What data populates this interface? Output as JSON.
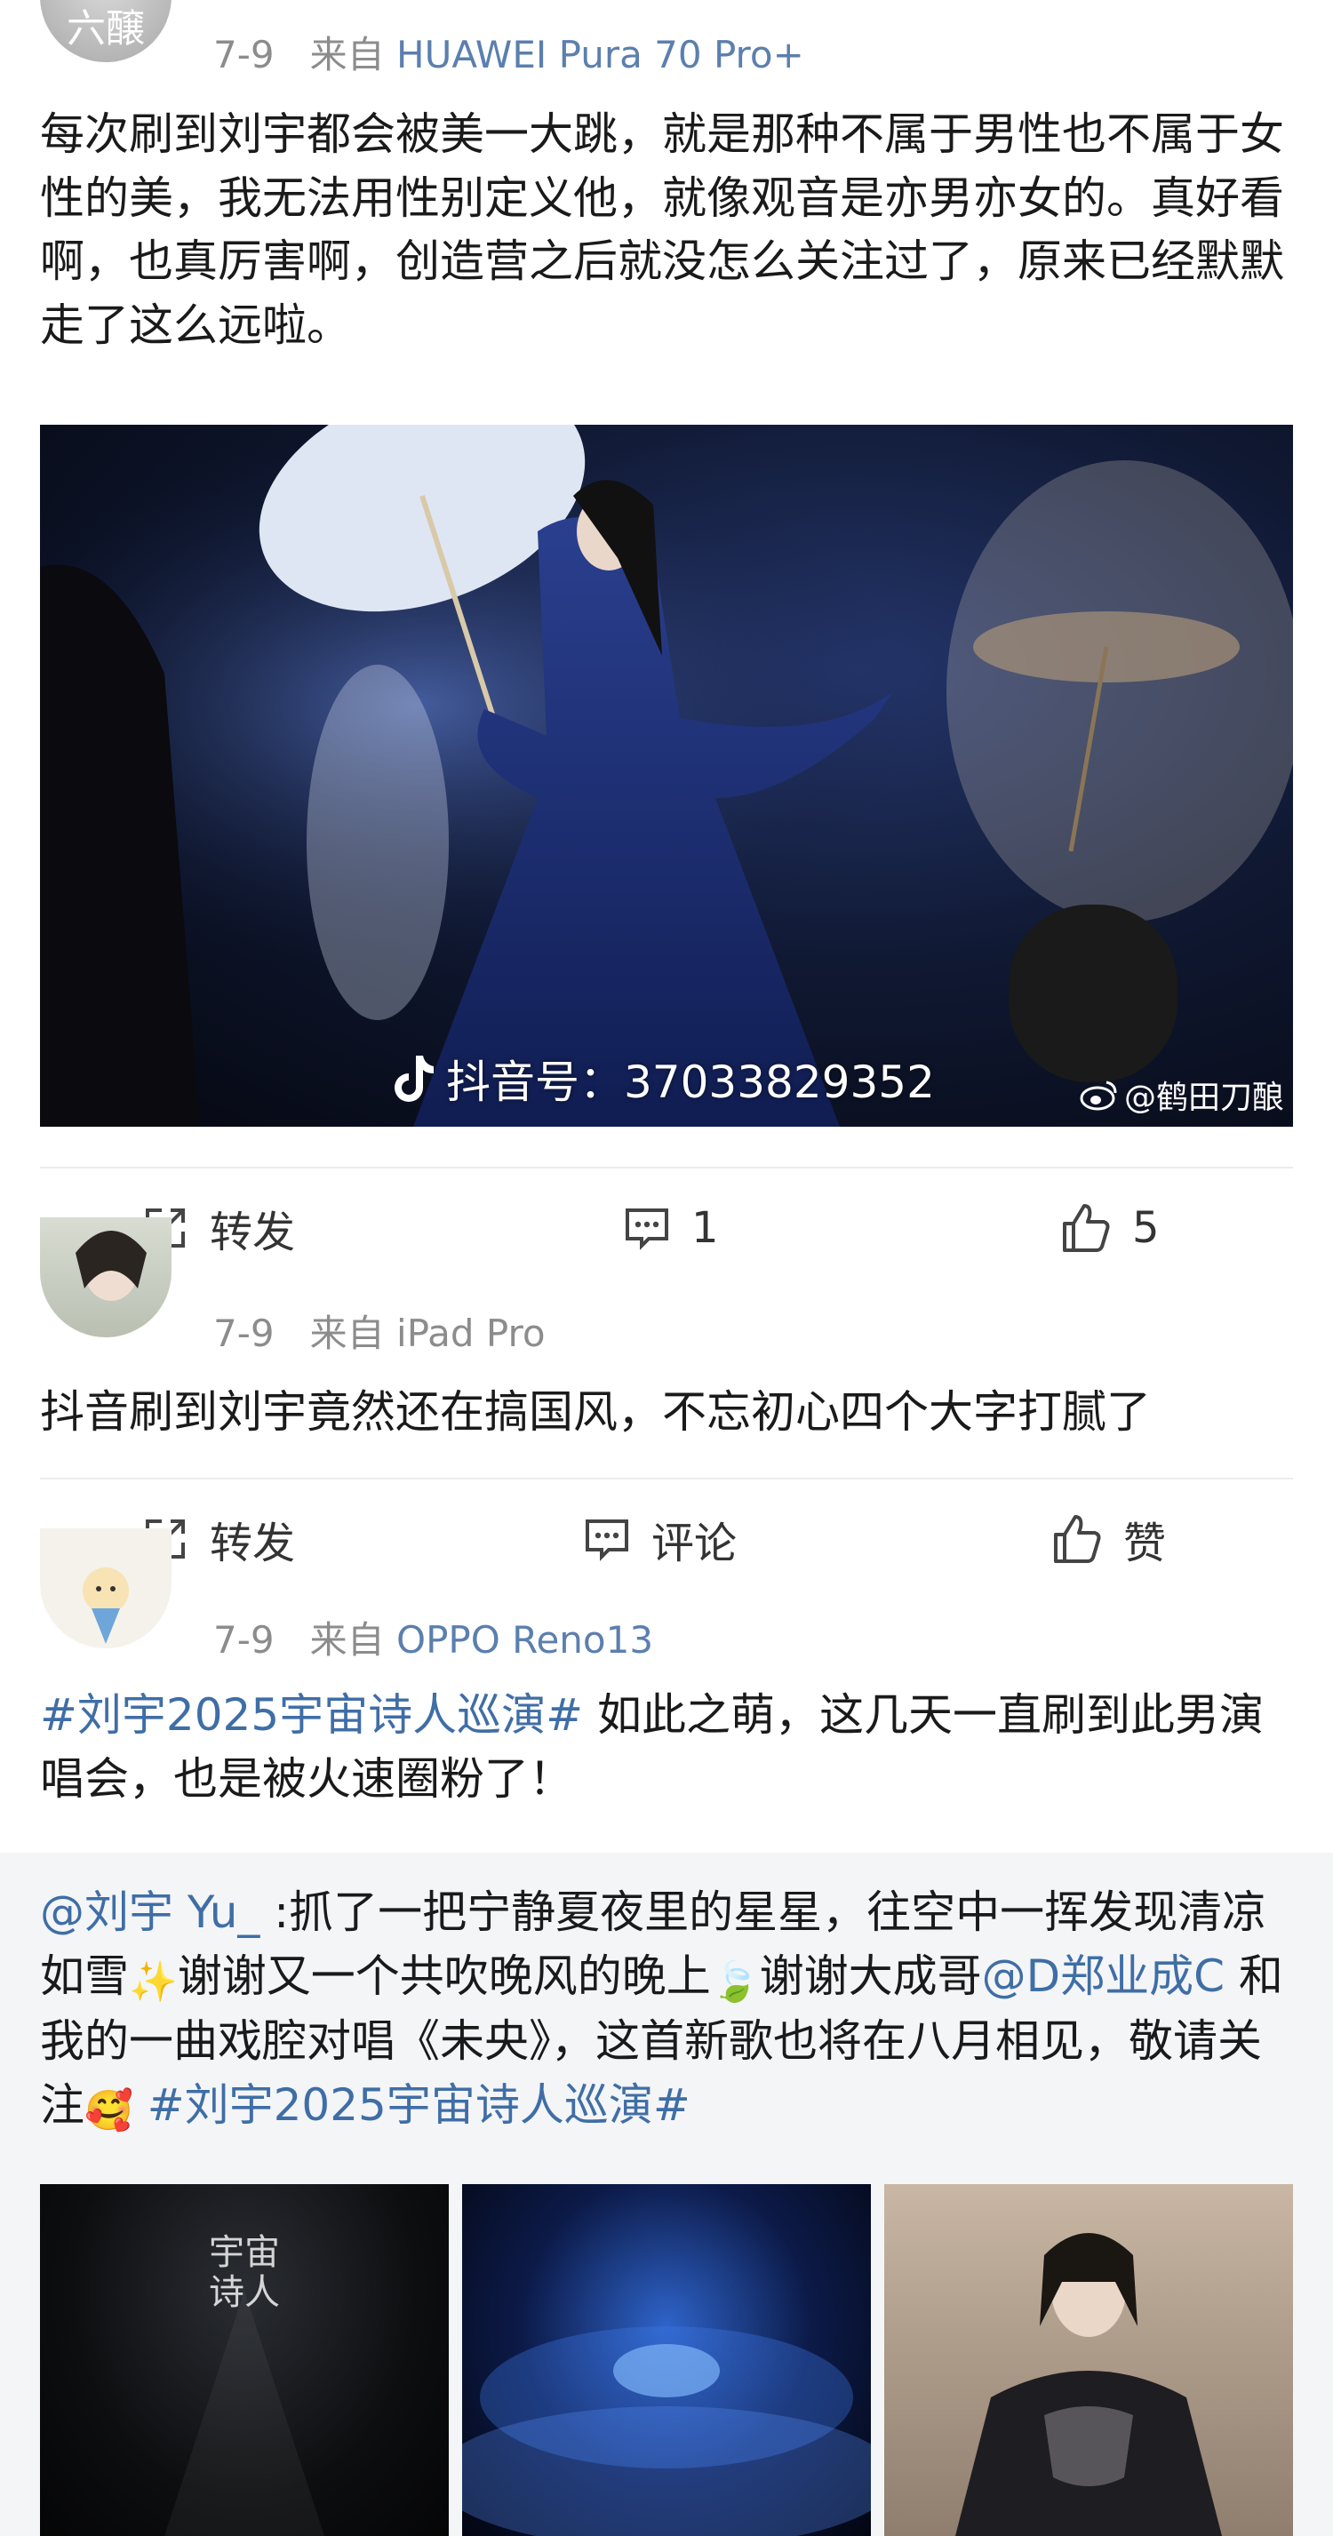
{
  "post1": {
    "date": "7-9",
    "from_label": "来自",
    "device": "HUAWEI Pura 70 Pro+",
    "text": "每次刷到刘宇都会被美一大跳，就是那种不属于男性也不属于女性的美，我无法用性别定义他，就像观音是亦男亦女的。真好看啊，也真厉害啊，创造营之后就没怎么关注过了，原来已经默默走了这么远啦。",
    "image_watermark_left": "抖音号：37033829352",
    "image_watermark_right": "@鹤田刀酿",
    "actions": {
      "repost": "转发",
      "comment": "1",
      "like": "5"
    }
  },
  "post2": {
    "date": "7-9",
    "from_label": "来自",
    "device": "iPad Pro",
    "text": "抖音刷到刘宇竟然还在搞国风，不忘初心四个大字打腻了",
    "actions": {
      "repost": "转发",
      "comment": "评论",
      "like": "赞"
    }
  },
  "post3": {
    "date": "7-9",
    "from_label": "来自",
    "device": "OPPO Reno13",
    "topic": "#刘宇2025宇宙诗人巡演#",
    "text_after_topic": " 如此之萌，这几天一直刷到此男演唱会，也是被火速圈粉了！",
    "repost": {
      "mention": "@刘宇 Yu_",
      "text_part1": " :抓了一把宁静夏夜里的星星，往空中一挥发现清凉如雪",
      "emoji1": "✨",
      "text_part2": "谢谢又一个共吹晚风的晚上",
      "emoji2": "🍃",
      "text_part3": "谢谢大成哥",
      "mention2": "@D郑业成C",
      "text_part4": " 和我的一曲戏腔对唱《未央》，这首新歌也将在八月相见，敬请关注",
      "emoji3": "🥰",
      "topic": " #刘宇2025宇宙诗人巡演#"
    }
  },
  "colors": {
    "link": "#3f6ea6",
    "meta_gray": "#8c8c8c",
    "repost_bg": "#f4f5f7"
  },
  "icons": [
    "repost-icon",
    "comment-icon",
    "like-icon",
    "tiktok-icon",
    "weibo-icon"
  ]
}
